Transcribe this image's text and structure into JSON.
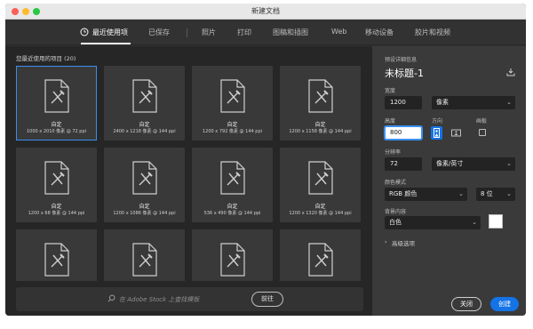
{
  "window": {
    "title": "新建文档"
  },
  "tabs": [
    {
      "label": "最近使用项",
      "active": true
    },
    {
      "label": "已保存"
    },
    {
      "label": "照片"
    },
    {
      "label": "打印"
    },
    {
      "label": "图稿和插图"
    },
    {
      "label": "Web"
    },
    {
      "label": "移动设备"
    },
    {
      "label": "胶片和视频"
    }
  ],
  "recent": {
    "heading": "您最近使用的项目",
    "count": "(20)",
    "items": [
      {
        "name": "自定",
        "meta": "1000 x 2010 像素 @ 72 ppi",
        "selected": true
      },
      {
        "name": "自定",
        "meta": "2400 x 1218 像素 @ 144 ppi"
      },
      {
        "name": "自定",
        "meta": "1200 x 792 像素 @ 144 ppi"
      },
      {
        "name": "自定",
        "meta": "1200 x 1158 像素 @ 144 ppi"
      },
      {
        "name": "自定",
        "meta": "1200 x 68 像素 @ 144 ppi"
      },
      {
        "name": "自定",
        "meta": "1200 x 1086 像素 @ 144 ppi"
      },
      {
        "name": "自定",
        "meta": "536 x 490 像素 @ 144 ppi"
      },
      {
        "name": "自定",
        "meta": "1200 x 1320 像素 @ 144 ppi"
      },
      {
        "name": "",
        "meta": ""
      },
      {
        "name": "",
        "meta": ""
      },
      {
        "name": "",
        "meta": ""
      },
      {
        "name": "",
        "meta": ""
      }
    ]
  },
  "search": {
    "placeholder": "在 Adobe Stock 上查找模板",
    "go_label": "前往"
  },
  "preset": {
    "section_label": "预设详细信息",
    "doc_title": "未标题-1",
    "width_label": "宽度",
    "width_value": "1200",
    "width_unit": "像素",
    "height_label": "高度",
    "height_value": "800",
    "orientation_label": "方向",
    "artboard_label": "画板",
    "resolution_label": "分辨率",
    "resolution_value": "72",
    "resolution_unit": "像素/英寸",
    "color_mode_label": "颜色模式",
    "color_mode": "RGB 颜色",
    "bit_depth": "8 位",
    "bg_label": "背景内容",
    "bg_value": "白色",
    "advanced_label": "高级选项"
  },
  "buttons": {
    "close": "关闭",
    "create": "创建"
  },
  "colors": {
    "accent": "#1473e6",
    "selection": "#3b8ff0",
    "panel": "#323232",
    "grid_bg": "#262626"
  }
}
